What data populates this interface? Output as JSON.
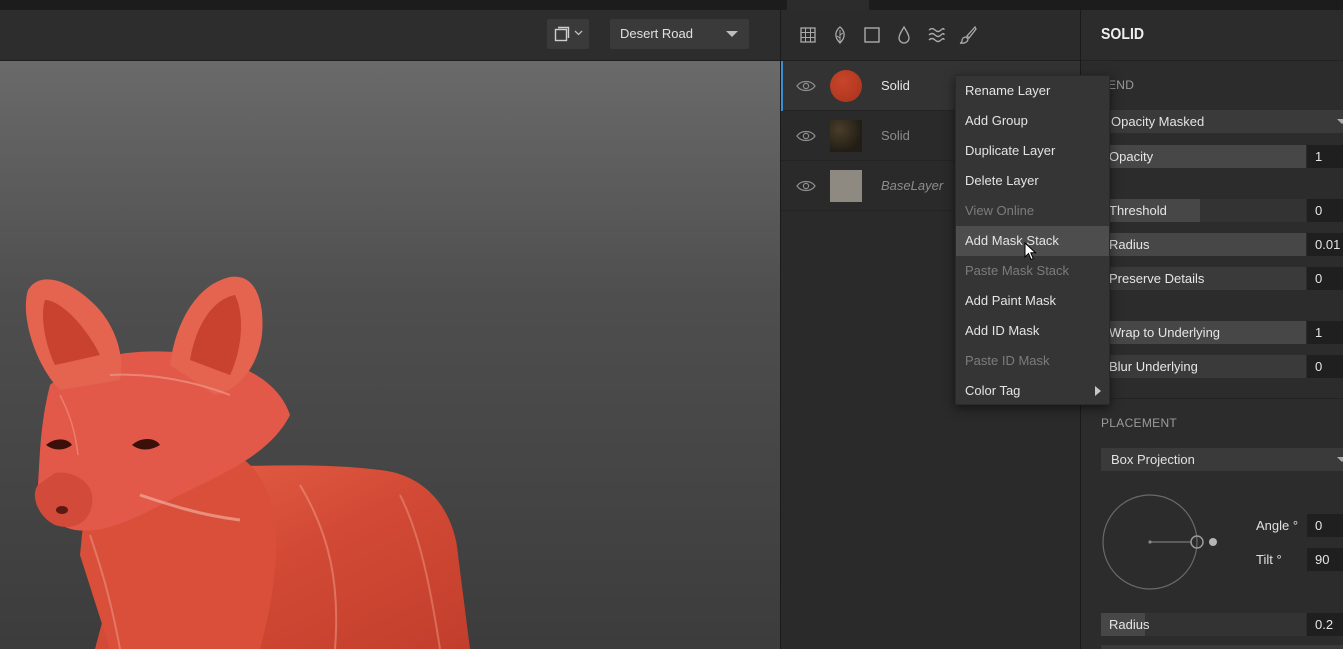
{
  "viewport": {
    "view_mode_icon": "single-viewport-icon",
    "environment": "Desert Road"
  },
  "layers_panel": {
    "tool_icons": [
      "grid-icon",
      "leaf-icon",
      "square-icon",
      "droplet-icon",
      "waves-icon",
      "brush-icon"
    ],
    "layers": [
      {
        "name": "Solid",
        "thumb_color": "#b8391f",
        "selected": true
      },
      {
        "name": "Solid",
        "thumb_color": "#2f2a20",
        "selected": false
      },
      {
        "name": "BaseLayer",
        "thumb_color": "#8e8a82",
        "selected": false
      }
    ],
    "context_menu": [
      {
        "label": "Rename Layer",
        "disabled": false
      },
      {
        "label": "Add Group",
        "disabled": false
      },
      {
        "label": "Duplicate Layer",
        "disabled": false
      },
      {
        "label": "Delete Layer",
        "disabled": false
      },
      {
        "label": "View Online",
        "disabled": true
      },
      {
        "label": "Add Mask Stack",
        "disabled": false,
        "hovered": true
      },
      {
        "label": "Paste Mask Stack",
        "disabled": true
      },
      {
        "label": "Add Paint Mask",
        "disabled": false
      },
      {
        "label": "Add ID Mask",
        "disabled": false
      },
      {
        "label": "Paste ID Mask",
        "disabled": true
      },
      {
        "label": "Color Tag",
        "disabled": false,
        "submenu": true
      }
    ]
  },
  "properties": {
    "title": "SOLID",
    "blend": {
      "section": "LEND",
      "mode": "Opacity Masked",
      "sliders": [
        {
          "label": "Opacity",
          "value": "1",
          "level": 1.0
        },
        {
          "label": "Threshold",
          "value": "0",
          "level": 0.48
        },
        {
          "label": "Radius",
          "value": "0.01",
          "level": 1.0
        },
        {
          "label": "Preserve Details",
          "value": "0",
          "level": 1.0
        },
        {
          "label": "Wrap to Underlying",
          "value": "1",
          "level": 1.0
        },
        {
          "label": "Blur Underlying",
          "value": "0",
          "level": 1.0
        }
      ]
    },
    "placement": {
      "section": "PLACEMENT",
      "projection": "Box Projection",
      "angle_label": "Angle °",
      "angle_value": "0",
      "tilt_label": "Tilt °",
      "tilt_value": "90",
      "radius_label": "Radius",
      "radius_value": "0.2",
      "radius_level": 0.2
    }
  }
}
